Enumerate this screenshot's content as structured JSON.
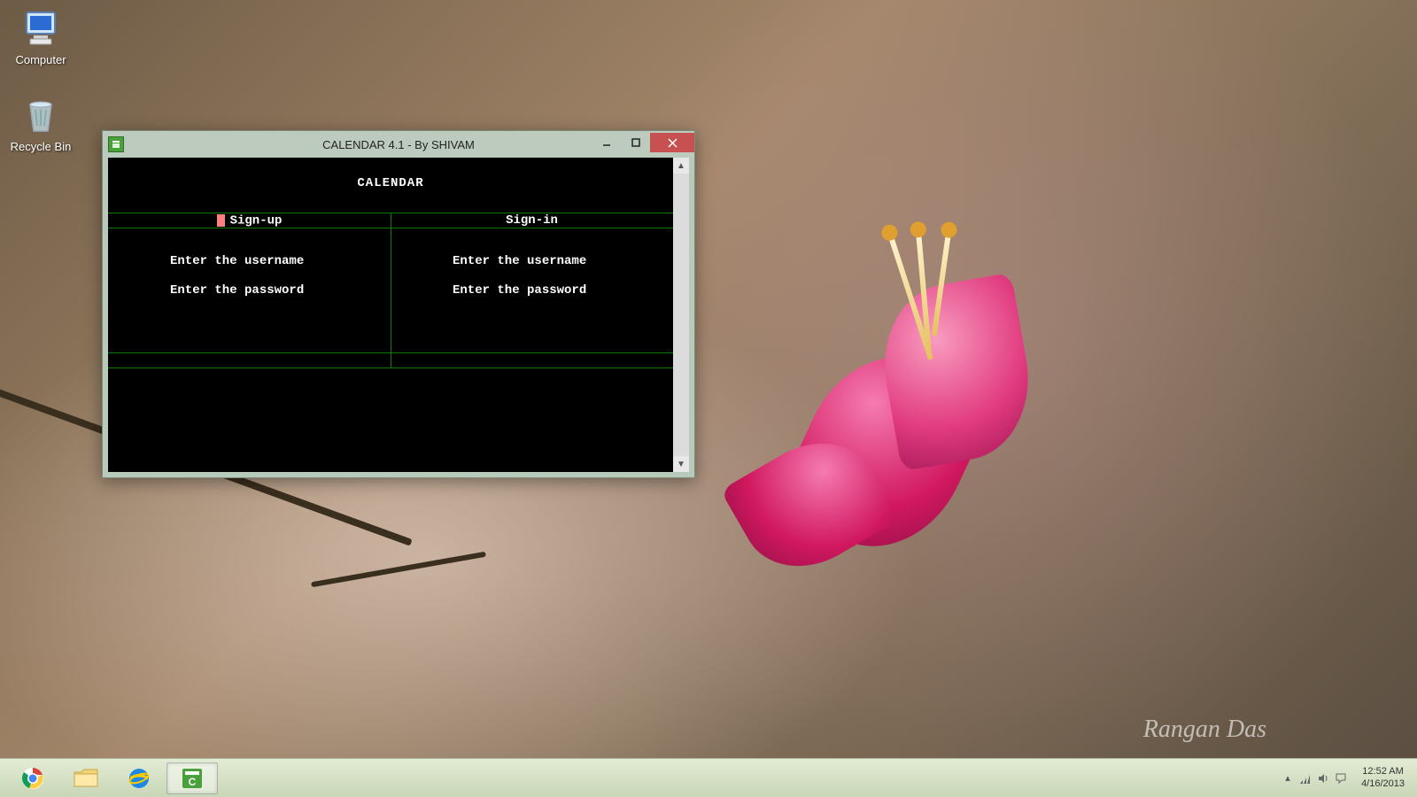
{
  "desktop": {
    "icons": [
      {
        "label": "Computer"
      },
      {
        "label": "Recycle Bin"
      }
    ],
    "wallpaper_signature": "Rangan Das"
  },
  "window": {
    "title": "CALENDAR 4.1 - By SHIVAM",
    "console": {
      "heading": "CALENDAR",
      "left": {
        "title": "Sign-up",
        "username_prompt": "Enter the username",
        "password_prompt": "Enter the password"
      },
      "right": {
        "title": "Sign-in",
        "username_prompt": "Enter the username",
        "password_prompt": "Enter the password"
      }
    }
  },
  "taskbar": {
    "items": [
      {
        "name": "chrome"
      },
      {
        "name": "file-explorer"
      },
      {
        "name": "internet-explorer"
      },
      {
        "name": "calendar-app",
        "active": true
      }
    ],
    "clock": {
      "time": "12:52 AM",
      "date": "4/16/2013"
    }
  }
}
